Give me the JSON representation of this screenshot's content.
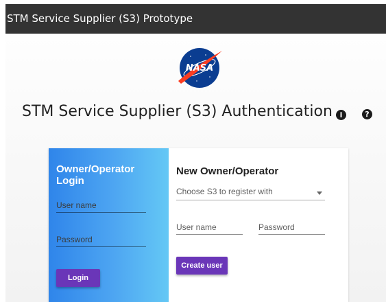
{
  "app": {
    "title": "STM Service Supplier (S3) Prototype"
  },
  "logo": {
    "text": "NASA"
  },
  "page": {
    "heading": "STM Service Supplier (S3) Authentication .",
    "info_icon": "info-icon",
    "help_icon": "help-icon"
  },
  "login": {
    "title": "Owner/Operator Login",
    "username_placeholder": "User name",
    "password_placeholder": "Password",
    "button_label": "Login"
  },
  "register": {
    "title": "New Owner/Operator",
    "select_placeholder": "Choose S3 to register with",
    "username_placeholder": "User name",
    "password_placeholder": "Password",
    "button_label": "Create user"
  },
  "colors": {
    "titlebar": "#333333",
    "accent_button": "#6a36b8",
    "login_gradient_start": "#2f85ea",
    "login_gradient_end": "#64c8f5",
    "nasa_blue": "#0b3d91",
    "nasa_red": "#fc3d21"
  }
}
